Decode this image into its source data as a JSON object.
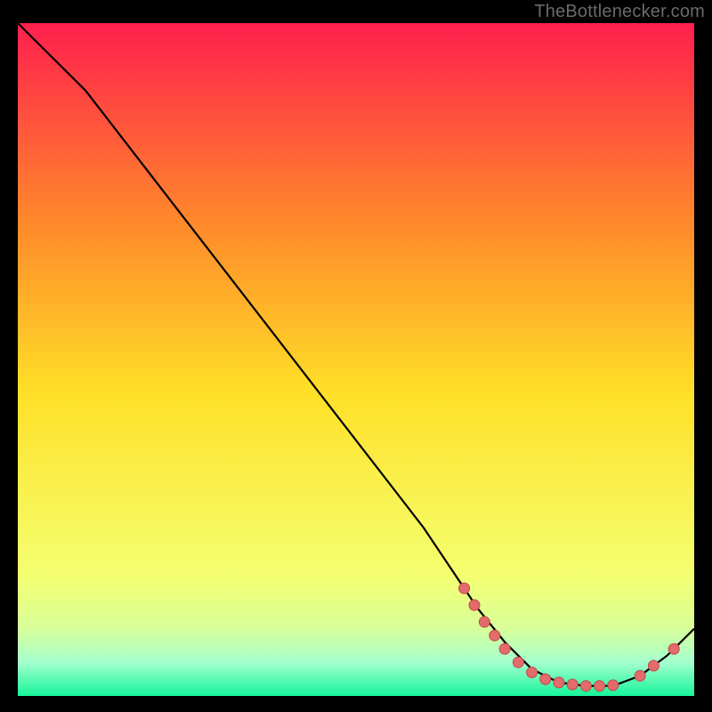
{
  "attribution": "TheBottlenecker.com",
  "colors": {
    "background": "#000000",
    "attribution_text": "#6a6a6a",
    "grad_top": "#ff1f4e",
    "grad_mid_upper": "#ff8a2a",
    "grad_mid": "#ffe028",
    "grad_lower": "#f4ff70",
    "grad_band1": "#d8ff9a",
    "grad_band2": "#a4ffce",
    "grad_bottom": "#16f59b",
    "curve": "#000000",
    "marker_fill": "#e46b6b",
    "marker_stroke": "#c04a4a"
  },
  "chart_data": {
    "type": "line",
    "title": "",
    "xlabel": "",
    "ylabel": "",
    "xlim": [
      0,
      100
    ],
    "ylim": [
      0,
      100
    ],
    "series": [
      {
        "name": "curve",
        "x": [
          0,
          6,
          10,
          20,
          30,
          40,
          50,
          60,
          68,
          72,
          76,
          80,
          84,
          88,
          92,
          96,
          100
        ],
        "y": [
          100,
          94,
          90,
          77,
          64,
          51,
          38,
          25,
          13,
          8,
          4,
          2,
          1.5,
          1.5,
          3,
          6,
          10
        ]
      }
    ],
    "markers": {
      "name": "highlight-dots",
      "x": [
        66,
        67.5,
        69,
        70.5,
        72,
        74,
        76,
        78,
        80,
        82,
        84,
        86,
        88,
        92,
        94,
        97
      ],
      "y": [
        16,
        13.5,
        11,
        9,
        7,
        5,
        3.5,
        2.5,
        2,
        1.7,
        1.5,
        1.5,
        1.6,
        3,
        4.5,
        7
      ]
    }
  }
}
